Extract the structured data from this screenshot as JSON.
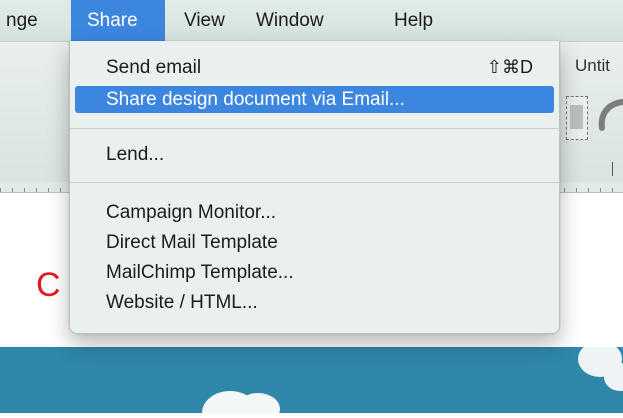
{
  "menubar": {
    "items": [
      {
        "label": "nge"
      },
      {
        "label": "Share",
        "active": true
      },
      {
        "label": "View"
      },
      {
        "label": "Window"
      },
      {
        "label": "Help"
      }
    ]
  },
  "toolbar": {
    "document_title": "Untit"
  },
  "share_menu": {
    "items": [
      {
        "label": "Send email",
        "shortcut": "⇧⌘D"
      },
      {
        "label": "Share design document via Email...",
        "highlighted": true
      },
      {
        "label": "Lend..."
      },
      {
        "label": "Campaign Monitor..."
      },
      {
        "label": "Direct Mail Template"
      },
      {
        "label": "MailChimp Template..."
      },
      {
        "label": "Website / HTML..."
      }
    ]
  },
  "canvas": {
    "visible_letter": "C"
  },
  "colors": {
    "highlight": "#3d86e0",
    "menubar_bg": "#d5e1dc",
    "canvas_letter": "#e01b24",
    "sky": "#2f87a9"
  }
}
